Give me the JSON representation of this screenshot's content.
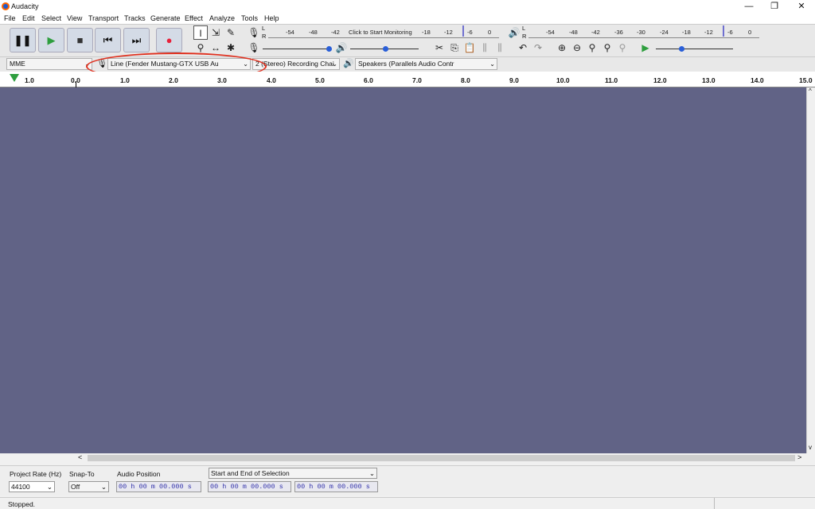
{
  "app": {
    "title": "Audacity"
  },
  "menu": [
    "File",
    "Edit",
    "Select",
    "View",
    "Transport",
    "Tracks",
    "Generate",
    "Effect",
    "Analyze",
    "Tools",
    "Help"
  ],
  "meters": {
    "record_scale": [
      "-54",
      "-48",
      "-42",
      "Click to Start Monitoring",
      "-18",
      "-12",
      "-6",
      "0"
    ],
    "play_scale": [
      "-54",
      "-48",
      "-42",
      "-36",
      "-30",
      "-24",
      "-18",
      "-12",
      "-6",
      "0"
    ],
    "lr_top": "L",
    "lr_bottom": "R"
  },
  "devices": {
    "host": "MME",
    "recording_device": "Line (Fender Mustang-GTX USB Au",
    "channels": "2 (Stereo) Recording Chai",
    "playback_device": "Speakers (Parallels Audio Contr"
  },
  "ruler": {
    "ticks": [
      "1.0",
      "0.0",
      "1.0",
      "2.0",
      "3.0",
      "4.0",
      "5.0",
      "6.0",
      "7.0",
      "8.0",
      "9.0",
      "10.0",
      "11.0",
      "12.0",
      "13.0",
      "14.0",
      "15.0"
    ]
  },
  "selection": {
    "project_rate_label": "Project Rate (Hz)",
    "project_rate": "44100",
    "snap_label": "Snap-To",
    "snap_value": "Off",
    "audio_position_label": "Audio Position",
    "selection_mode": "Start and End of Selection",
    "audio_position": "00 h 00 m 00.000 s",
    "start": "00 h 00 m 00.000 s",
    "end": "00 h 00 m 00.000 s"
  },
  "status": {
    "text": "Stopped."
  },
  "colors": {
    "track_bg": "#616386",
    "annotation": "#e0301e",
    "record": "#e8213a",
    "play": "#2e9e3e"
  }
}
